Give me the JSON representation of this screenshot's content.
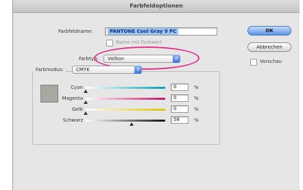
{
  "dialog": {
    "title": "Farbfeldoptionen"
  },
  "form": {
    "name_label": "Farbfeldname:",
    "name_value": "PANTONE Cool Gray 9 PC",
    "name_checkbox_label": "Name mit Farbwert",
    "type_label": "Farbtyp:",
    "type_value": "Vollton",
    "mode_label": "Farbmodus:",
    "mode_value": "CMYK"
  },
  "sliders": [
    {
      "label": "Cyan",
      "value": "0",
      "unit": "%",
      "fraction": 0.0,
      "color": "#00a3b8"
    },
    {
      "label": "Magenta",
      "value": "0",
      "unit": "%",
      "fraction": 0.0,
      "color": "#c8106e"
    },
    {
      "label": "Gelb",
      "value": "0",
      "unit": "%",
      "fraction": 0.0,
      "color": "#d8c300"
    },
    {
      "label": "Schwarz",
      "value": "58",
      "unit": "%",
      "fraction": 0.58,
      "color": "#111111"
    }
  ],
  "buttons": {
    "ok": "OK",
    "cancel": "Abbrechen",
    "preview": "Vorschau"
  },
  "swatch_color": "#a6a8a1",
  "highlight_color": "#e0308c"
}
